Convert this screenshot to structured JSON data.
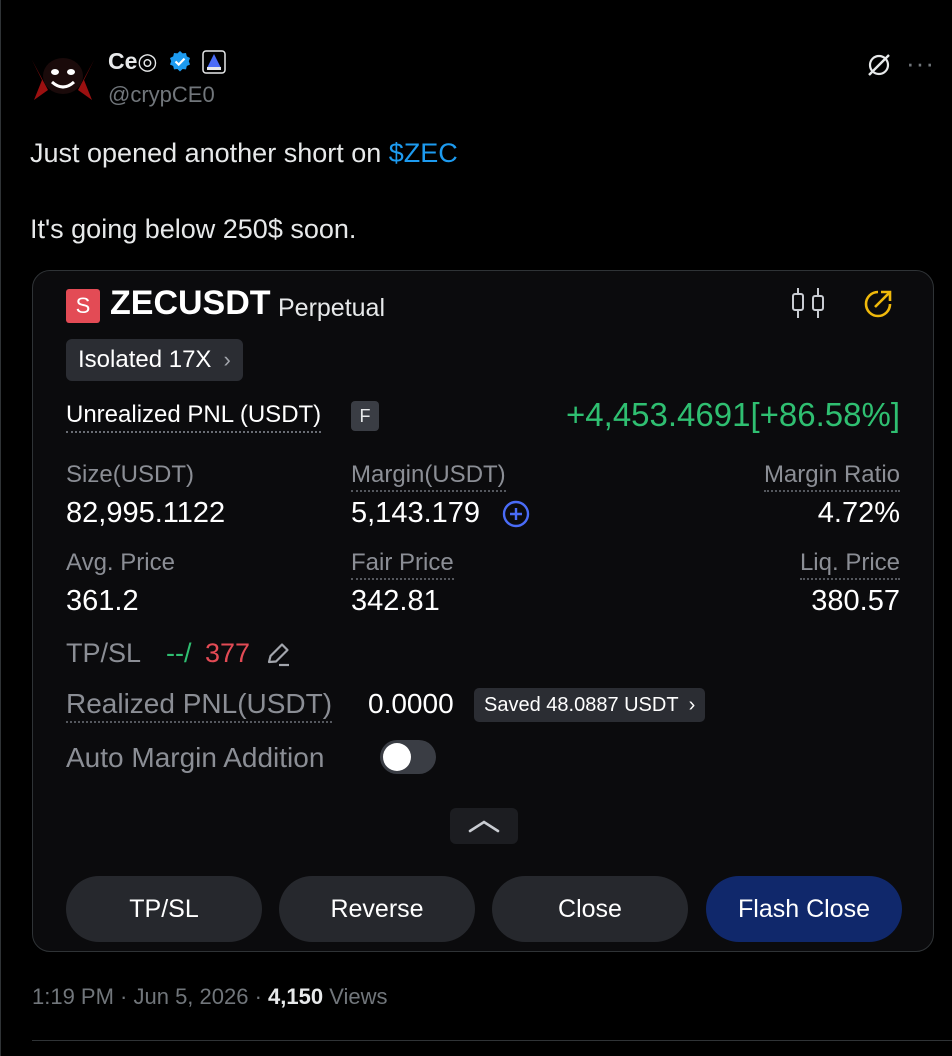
{
  "author": {
    "name": "Ce◎",
    "handle": "@crypCE0",
    "avatar_icon": "red-demon-avatar",
    "verified_icon": "verified-badge-icon",
    "affiliate_icon": "affiliate-badge-icon"
  },
  "header_actions": {
    "grok_icon": "grok-icon",
    "more_icon": "more-options-icon",
    "more_label": "···"
  },
  "tweet": {
    "line1_text": "Just opened another short on ",
    "cashtag": "$ZEC",
    "line2": "It's going below 250$ soon."
  },
  "position": {
    "side_badge": "S",
    "symbol": "ZECUSDT",
    "contract_type": "Perpetual",
    "leverage": "Isolated 17X",
    "leverage_chevron": "›",
    "unrealized_pnl_label": "Unrealized PNL (USDT)",
    "f_badge": "F",
    "unrealized_pnl_value": "+4,453.4691[+86.58%]",
    "size_label": "Size(USDT)",
    "size_value": "82,995.1122",
    "margin_label": "Margin(USDT)",
    "margin_value": "5,143.179",
    "margin_ratio_label": "Margin Ratio",
    "margin_ratio_value": "4.72%",
    "avg_price_label": "Avg. Price",
    "avg_price_value": "361.2",
    "fair_price_label": "Fair Price",
    "fair_price_value": "342.81",
    "liq_price_label": "Liq. Price",
    "liq_price_value": "380.57",
    "tpsl_label": "TP/SL",
    "tp_value": "--/",
    "sl_value": "377",
    "realized_pnl_label": "Realized PNL(USDT)",
    "realized_pnl_value": "0.0000",
    "saved_label": "Saved 48.0887 USDT",
    "saved_chevron": "›",
    "auto_margin_label": "Auto Margin Addition",
    "auto_margin_on": false
  },
  "buttons": {
    "tpsl": "TP/SL",
    "reverse": "Reverse",
    "close": "Close",
    "flash_close": "Flash Close"
  },
  "colors": {
    "profit": "#2fbf71",
    "loss": "#e34b55",
    "link": "#1d9bf0",
    "flash_close_bg": "#10286b"
  },
  "meta": {
    "time": "1:19 PM · Jun 5, 2026 · ",
    "views_count": "4,150",
    "views_label": " Views"
  }
}
